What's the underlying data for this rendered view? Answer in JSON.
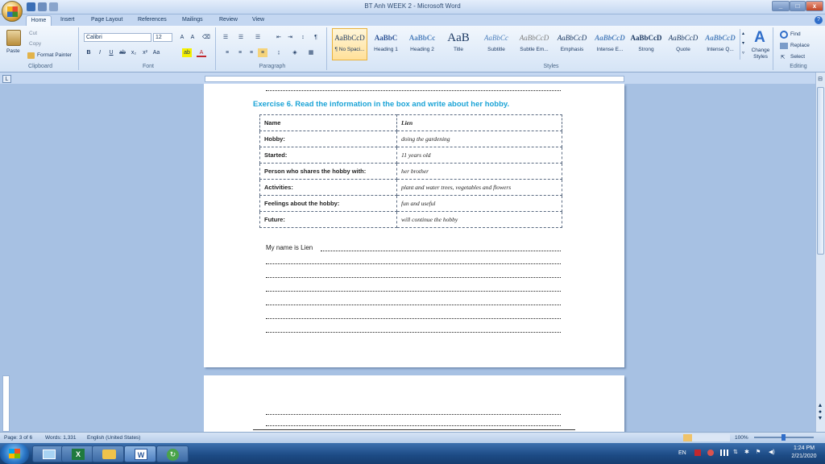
{
  "window": {
    "title": "BT Anh WEEK 2 - Microsoft Word"
  },
  "tabs": [
    "Home",
    "Insert",
    "Page Layout",
    "References",
    "Mailings",
    "Review",
    "View"
  ],
  "clipboard": {
    "paste": "Paste",
    "cut": "Cut",
    "copy": "Copy",
    "format_painter": "Format Painter",
    "label": "Clipboard"
  },
  "font": {
    "name": "Calibri",
    "size": "12",
    "label": "Font"
  },
  "paragraph": {
    "label": "Paragraph"
  },
  "styles": {
    "label": "Styles",
    "change": "Change Styles",
    "items": [
      {
        "sample": "AaBbCcD",
        "name": "¶ No Spaci..."
      },
      {
        "sample": "AaBbC",
        "name": "Heading 1"
      },
      {
        "sample": "AaBbCc",
        "name": "Heading 2"
      },
      {
        "sample": "AaB",
        "name": "Title"
      },
      {
        "sample": "AaBbCc",
        "name": "Subtitle"
      },
      {
        "sample": "AaBbCcD",
        "name": "Subtle Em..."
      },
      {
        "sample": "AaBbCcD",
        "name": "Emphasis"
      },
      {
        "sample": "AaBbCcD",
        "name": "Intense E..."
      },
      {
        "sample": "AaBbCcD",
        "name": "Strong"
      },
      {
        "sample": "AaBbCcD",
        "name": "Quote"
      },
      {
        "sample": "AaBbCcD",
        "name": "Intense Q..."
      }
    ]
  },
  "editing": {
    "find": "Find",
    "replace": "Replace",
    "select": "Select",
    "label": "Editing"
  },
  "document": {
    "exercise_title": "Exercise 6. Read the information in the box and write about her hobby.",
    "table": [
      {
        "key": "Name",
        "value": "Lien"
      },
      {
        "key": "Hobby:",
        "value": "doing the gardening"
      },
      {
        "key": "Started:",
        "value": "11 years old"
      },
      {
        "key": "Person who shares the hobby with:",
        "value": "her brother"
      },
      {
        "key": "Activities:",
        "value": "plant and water trees, vegetables and flowers"
      },
      {
        "key": "Feelings about the hobby:",
        "value": "fun and useful"
      },
      {
        "key": "Future:",
        "value": "will continue the hobby"
      }
    ],
    "intro": "My name is Lien"
  },
  "status": {
    "page": "Page: 3 of 6",
    "words": "Words: 1,331",
    "language": "English (United States)",
    "zoom": "100%"
  },
  "tray": {
    "lang": "EN",
    "time": "1:24 PM",
    "date": "2/21/2020"
  },
  "colors": {
    "accent": "#1aa3d6",
    "ribbon": "#dfe9f7",
    "taskbar": "#1c4a84"
  }
}
